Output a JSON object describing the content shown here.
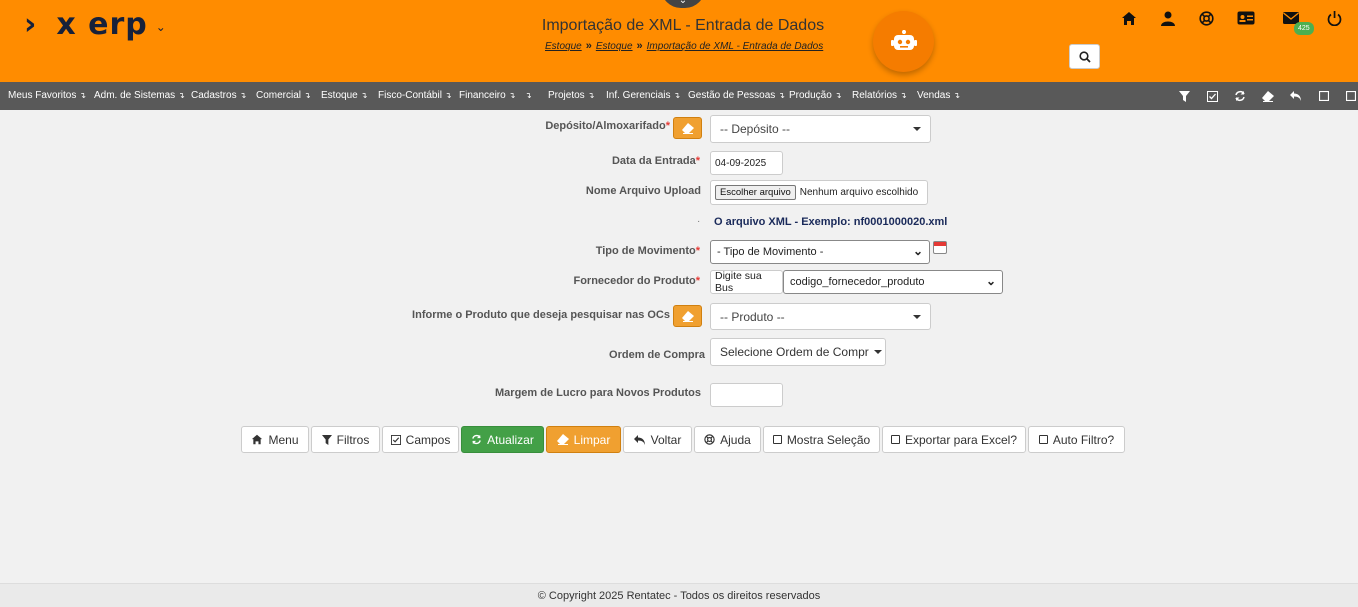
{
  "header": {
    "brand": "x erp",
    "title": "Importação de XML - Entrada de Dados",
    "breadcrumb": [
      "Estoque",
      "Estoque",
      "Importação de XML - Entrada de Dados"
    ],
    "mail_badge": "425",
    "accent_color": "#ff8c00"
  },
  "nav": {
    "items": [
      "Meus Favoritos",
      "Adm. de Sistemas",
      "Cadastros",
      "Comercial",
      "Estoque",
      "Fisco-Contábil",
      "Financeiro",
      "",
      "Projetos",
      "Inf. Gerenciais",
      "Gestão de Pessoas",
      "Produção",
      "Relatórios",
      "Vendas"
    ]
  },
  "form": {
    "deposito_label": "Depósito/Almoxarifado",
    "deposito_value": "-- Depósito --",
    "data_label": "Data da Entrada",
    "data_value": "04-09-2025",
    "arquivo_label": "Nome Arquivo Upload",
    "arquivo_button": "Escolher arquivo",
    "arquivo_none": "Nenhum arquivo escolhido",
    "note_dot": "·",
    "note": "O arquivo XML - Exemplo: nf0001000020.xml",
    "tipo_label": "Tipo de Movimento",
    "tipo_value": "- Tipo de Movimento -",
    "fornecedor_label": "Fornecedor do Produto",
    "fornecedor_search": "Digite sua Bus",
    "fornecedor_select": "codigo_fornecedor_produto",
    "produto_label": "Informe o Produto que deseja pesquisar nas OCs",
    "produto_value": "-- Produto --",
    "ordem_label": "Ordem de Compra",
    "ordem_value": "Selecione Ordem de Compr",
    "margem_label": "Margem de Lucro para Novos Produtos",
    "margem_value": ""
  },
  "toolbar": {
    "menu": "Menu",
    "filtros": "Filtros",
    "campos": "Campos",
    "atualizar": "Atualizar",
    "limpar": "Limpar",
    "voltar": "Voltar",
    "ajuda": "Ajuda",
    "mostra_selecao": "Mostra Seleção",
    "exportar_excel": "Exportar para Excel?",
    "auto_filtro": "Auto Filtro?"
  },
  "footer": {
    "copyright": "© Copyright 2025 Rentatec - Todos os direitos reservados"
  }
}
